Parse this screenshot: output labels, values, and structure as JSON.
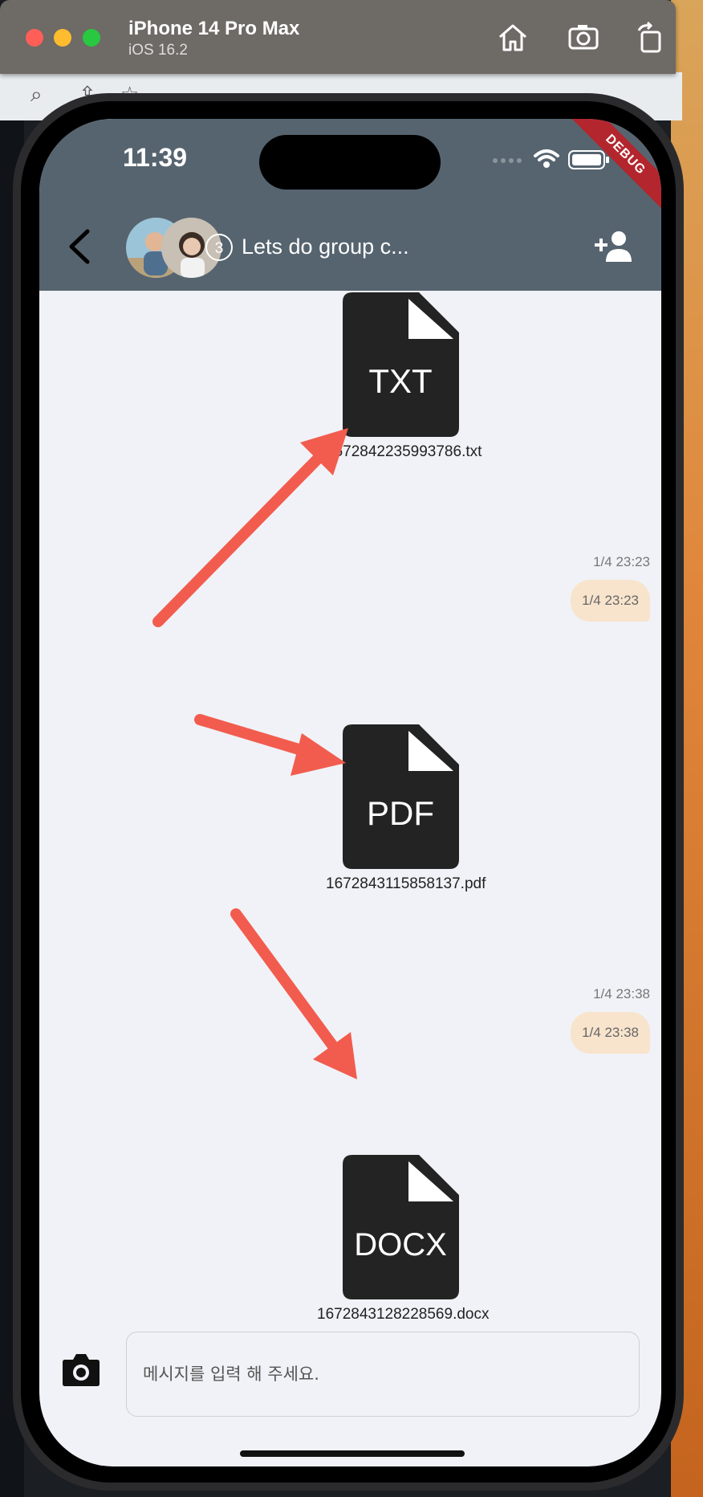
{
  "simulator": {
    "device": "iPhone 14 Pro Max",
    "os": "iOS 16.2"
  },
  "status_bar": {
    "time": "11:39",
    "debug_banner": "DEBUG"
  },
  "chat": {
    "member_count": "3",
    "title": "Lets do group c..."
  },
  "messages": [
    {
      "type": "file",
      "file_type": "TXT",
      "filename": "1672842235993786.txt"
    },
    {
      "timestamp": "1/4 23:23",
      "bubble_text": "1/4 23:23"
    },
    {
      "type": "file",
      "file_type": "PDF",
      "filename": "1672843115858137.pdf"
    },
    {
      "timestamp": "1/4 23:38",
      "bubble_text": "1/4 23:38"
    },
    {
      "type": "file",
      "file_type": "DOCX",
      "filename": "1672843128228569.docx"
    }
  ],
  "composer": {
    "placeholder": "메시지를 입력 해 주세요."
  },
  "colors": {
    "appbar": "#56646f",
    "chat_bg": "#f0f2f7",
    "bubble": "#f8e4cc",
    "file_icon": "#232323",
    "annotation_arrow": "#f25c4e"
  },
  "icons": [
    "back-chevron-icon",
    "add-user-icon",
    "camera-icon",
    "wifi-icon",
    "battery-icon",
    "home-icon",
    "screenshot-icon",
    "rotate-icon"
  ]
}
